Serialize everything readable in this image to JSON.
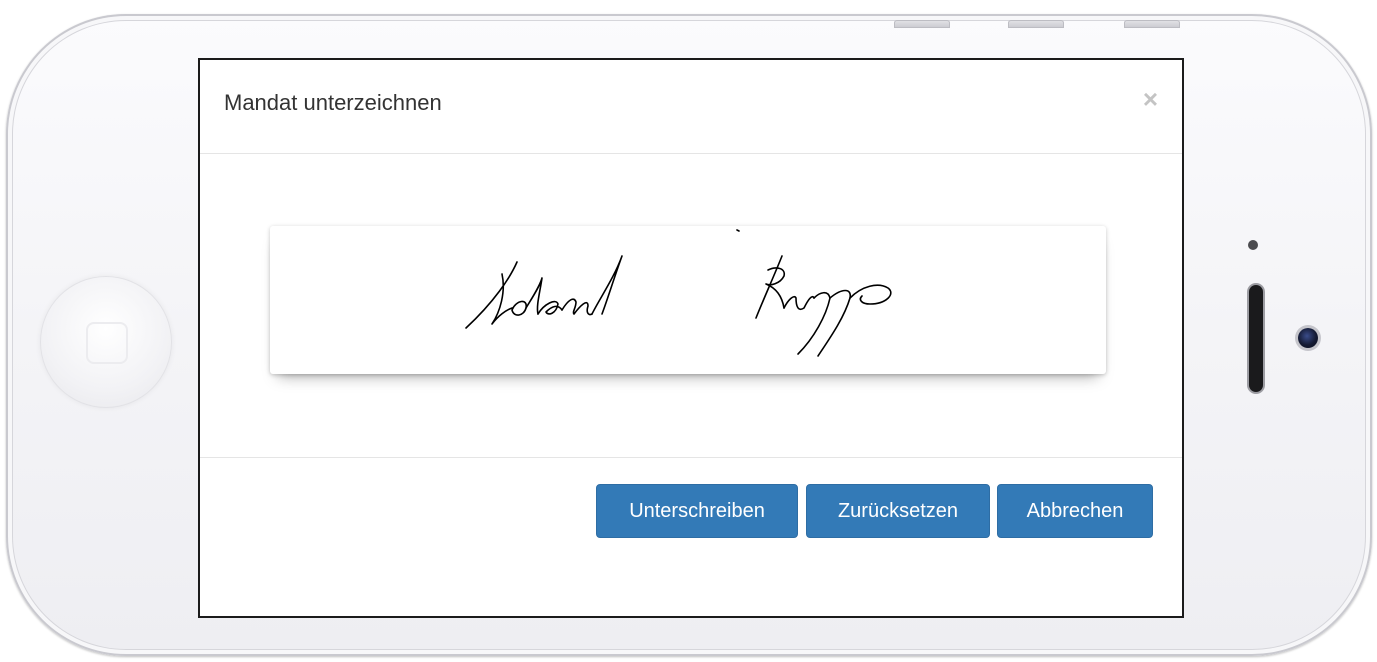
{
  "modal": {
    "title": "Mandat unterzeichnen",
    "close_symbol": "×"
  },
  "signature": {
    "signer_text": "Roland Rupp"
  },
  "footer": {
    "sign_label": "Unterschreiben",
    "reset_label": "Zurücksetzen",
    "cancel_label": "Abbrechen"
  },
  "colors": {
    "primary": "#337ab7",
    "ink": "#000000"
  },
  "icons": {
    "close": "close-icon",
    "home": "home-button-icon",
    "camera": "camera-icon",
    "speaker": "speaker-icon"
  }
}
